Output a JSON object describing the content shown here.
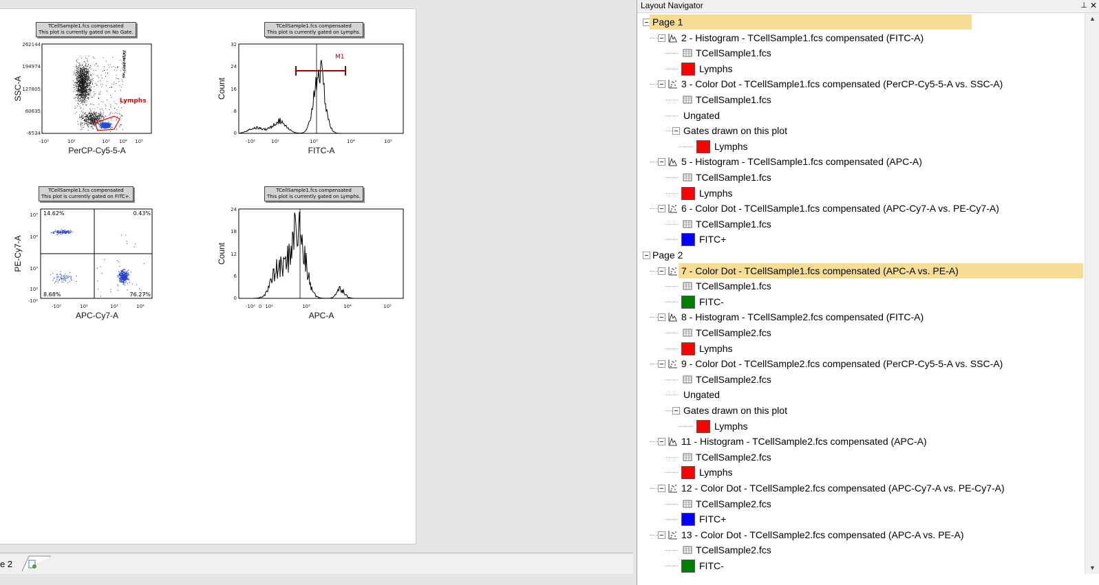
{
  "layout_tab": {
    "label": "e 2"
  },
  "navigator": {
    "title": "Layout Navigator",
    "pin_glyph": "⊥",
    "close_glyph": "✕",
    "rows": [
      {
        "label": "Page 1",
        "level": 0,
        "type": "page",
        "highlight": true
      },
      {
        "label": "2 - Histogram - TCellSample1.fcs compensated (FITC-A)",
        "level": 1,
        "type": "histogram"
      },
      {
        "label": "TCellSample1.fcs",
        "level": 2,
        "type": "file"
      },
      {
        "label": "Lymphs",
        "level": 2,
        "type": "gate",
        "color": "#ff0000"
      },
      {
        "label": "3 - Color Dot - TCellSample1.fcs compensated (PerCP-Cy5-5-A vs. SSC-A)",
        "level": 1,
        "type": "dot"
      },
      {
        "label": "TCellSample1.fcs",
        "level": 2,
        "type": "file"
      },
      {
        "label": "Ungated",
        "level": 2,
        "type": "text"
      },
      {
        "label": "Gates drawn on this plot",
        "level": 2,
        "type": "group"
      },
      {
        "label": "Lymphs",
        "level": 3,
        "type": "gate",
        "color": "#ff0000"
      },
      {
        "label": "5 - Histogram - TCellSample1.fcs compensated (APC-A)",
        "level": 1,
        "type": "histogram"
      },
      {
        "label": "TCellSample1.fcs",
        "level": 2,
        "type": "file"
      },
      {
        "label": "Lymphs",
        "level": 2,
        "type": "gate",
        "color": "#ff0000"
      },
      {
        "label": "6 - Color Dot - TCellSample1.fcs compensated (APC-Cy7-A vs. PE-Cy7-A)",
        "level": 1,
        "type": "dot"
      },
      {
        "label": "TCellSample1.fcs",
        "level": 2,
        "type": "file"
      },
      {
        "label": "FITC+",
        "level": 2,
        "type": "gate",
        "color": "#0000ff"
      },
      {
        "label": "Page 2",
        "level": 0,
        "type": "page"
      },
      {
        "label": "7 - Color Dot - TCellSample1.fcs compensated (APC-A vs. PE-A)",
        "level": 1,
        "type": "dot",
        "highlight": true
      },
      {
        "label": "TCellSample1.fcs",
        "level": 2,
        "type": "file"
      },
      {
        "label": "FITC-",
        "level": 2,
        "type": "gate",
        "color": "#008000"
      },
      {
        "label": "8 - Histogram - TCellSample2.fcs compensated (FITC-A)",
        "level": 1,
        "type": "histogram"
      },
      {
        "label": "TCellSample2.fcs",
        "level": 2,
        "type": "file"
      },
      {
        "label": "Lymphs",
        "level": 2,
        "type": "gate",
        "color": "#ff0000"
      },
      {
        "label": "9 - Color Dot - TCellSample2.fcs compensated (PerCP-Cy5-5-A vs. SSC-A)",
        "level": 1,
        "type": "dot"
      },
      {
        "label": "TCellSample2.fcs",
        "level": 2,
        "type": "file"
      },
      {
        "label": "Ungated",
        "level": 2,
        "type": "text"
      },
      {
        "label": "Gates drawn on this plot",
        "level": 2,
        "type": "group"
      },
      {
        "label": "Lymphs",
        "level": 3,
        "type": "gate",
        "color": "#ff0000"
      },
      {
        "label": "11 - Histogram - TCellSample2.fcs compensated (APC-A)",
        "level": 1,
        "type": "histogram"
      },
      {
        "label": "TCellSample2.fcs",
        "level": 2,
        "type": "file"
      },
      {
        "label": "Lymphs",
        "level": 2,
        "type": "gate",
        "color": "#ff0000"
      },
      {
        "label": "12 - Color Dot - TCellSample2.fcs compensated (APC-Cy7-A vs. PE-Cy7-A)",
        "level": 1,
        "type": "dot"
      },
      {
        "label": "TCellSample2.fcs",
        "level": 2,
        "type": "file"
      },
      {
        "label": "FITC+",
        "level": 2,
        "type": "gate",
        "color": "#0000ff"
      },
      {
        "label": "13 - Color Dot - TCellSample2.fcs compensated (APC-A vs. PE-A)",
        "level": 1,
        "type": "dot"
      },
      {
        "label": "TCellSample2.fcs",
        "level": 2,
        "type": "file"
      },
      {
        "label": "FITC-",
        "level": 2,
        "type": "gate",
        "color": "#008000"
      }
    ]
  },
  "plots": {
    "p1": {
      "stats_line1": "TCellSample1.fcs compensated",
      "stats_line2": "This plot is currently gated on No Gate.",
      "xlabel": "PerCP-Cy5-5-A",
      "ylabel": "SSC-A",
      "yticks": [
        "262144",
        "194974",
        "127805",
        "60635",
        "-6534"
      ],
      "xticks": [
        "-10²",
        "10²",
        "10³",
        "10⁴",
        "10⁵"
      ],
      "gate_label": "Lymphs"
    },
    "p2": {
      "stats_line1": "TCellSample1.fcs compensated",
      "stats_line2": "This plot is currently gated on Lymphs.",
      "xlabel": "FITC-A",
      "ylabel": "Count",
      "yticks": [
        "32",
        "24",
        "16",
        "8",
        "0"
      ],
      "xticks": [
        "-10²",
        "10²",
        "10³",
        "10⁴",
        "10⁵"
      ],
      "marker_label": "M1"
    },
    "p3": {
      "stats_line1": "TCellSample1.fcs compensated",
      "stats_line2": "This plot is currently gated on FITC+.",
      "xlabel": "APC-Cy7-A",
      "ylabel": "PE-Cy7-A",
      "yticks": [
        "10⁵",
        "10⁴",
        "10³",
        "10²",
        "-10²"
      ],
      "xticks": [
        "-10²",
        "10²",
        "10³",
        "10⁴"
      ],
      "quadrants": {
        "ul": "14.62%",
        "ur": "0.43%",
        "ll": "8.68%",
        "lr": "76.27%"
      }
    },
    "p4": {
      "stats_line1": "TCellSample1.fcs compensated",
      "stats_line2": "This plot is currently gated on Lymphs.",
      "xlabel": "APC-A",
      "ylabel": "Count",
      "yticks": [
        "24",
        "18",
        "12",
        "6",
        "0"
      ],
      "xticks": [
        "-10²",
        "0",
        "10²",
        "10³",
        "10⁴",
        "10⁵"
      ]
    }
  }
}
